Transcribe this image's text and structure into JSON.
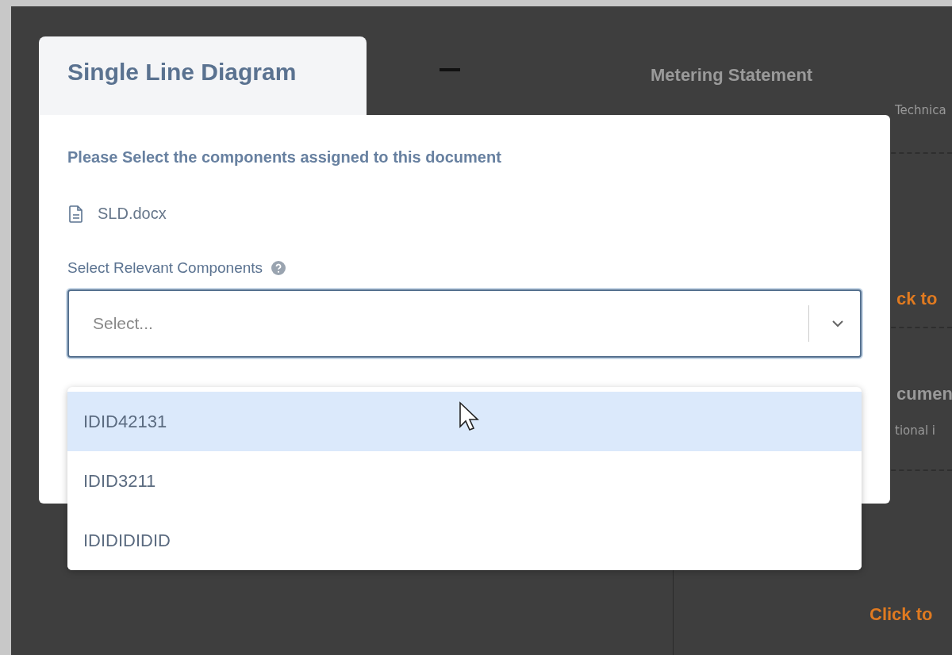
{
  "background": {
    "title": "Metering Statement",
    "subtitle": "Technica",
    "link_1": "ck to",
    "heading_2": "cumen",
    "text_2": "tional i",
    "link_2": "Click to"
  },
  "modal": {
    "tab": "Single Line Diagram",
    "heading": "Please Select the components assigned to this document",
    "file": "SLD.docx",
    "label": "Select Relevant Components",
    "select": {
      "placeholder": "Select..."
    },
    "options": [
      {
        "label": "IDID42131",
        "selected": true
      },
      {
        "label": "IDID3211",
        "selected": false
      },
      {
        "label": "IDIDIDIDID",
        "selected": false
      }
    ]
  }
}
